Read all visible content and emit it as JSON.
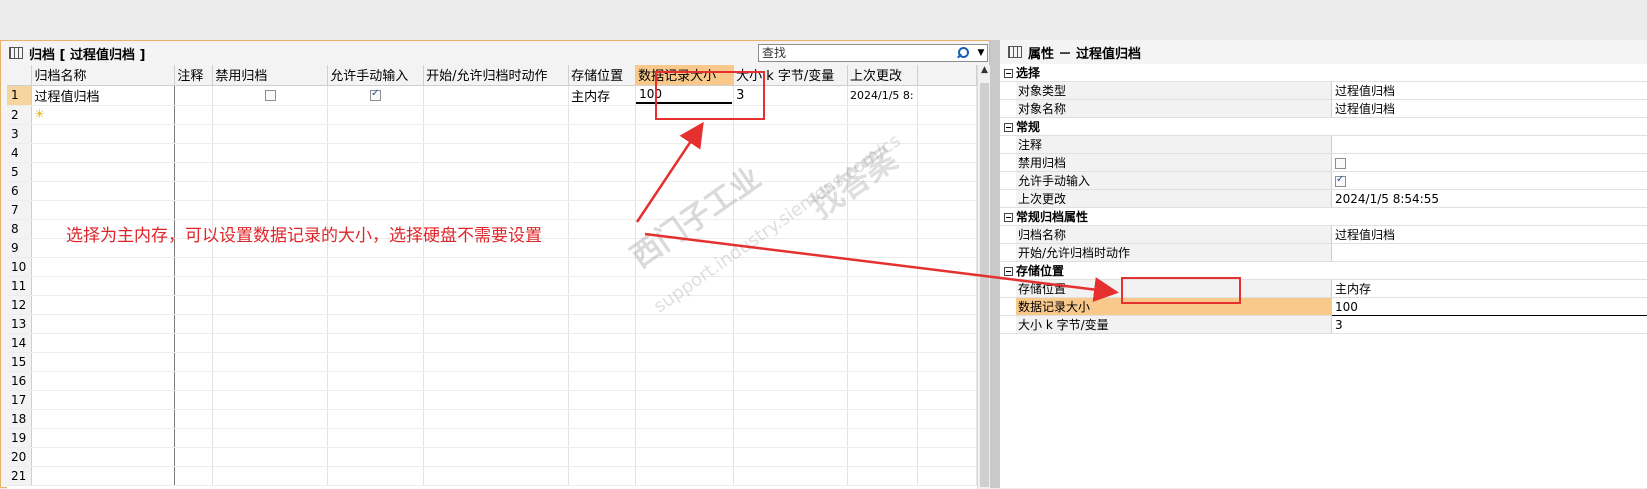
{
  "left_panel": {
    "title": "归档 [ 过程值归档 ]",
    "search_placeholder": "查找",
    "columns": [
      "归档名称",
      "注释",
      "禁用归档",
      "允许手动输入",
      "开始/允许归档时动作",
      "存储位置",
      "数据记录大小",
      "大小 k 字节/变量",
      "上次更改"
    ],
    "row1": {
      "num": "1",
      "name": "过程值归档",
      "comment": "",
      "disabled": false,
      "manual_input": true,
      "action": "",
      "storage": "主内存",
      "record_size": "100",
      "size_kb": "3",
      "last_change": "2024/1/5 8:"
    },
    "row_numbers": [
      "2",
      "3",
      "4",
      "5",
      "6",
      "7",
      "8",
      "9",
      "10",
      "11",
      "12",
      "13",
      "14",
      "15",
      "16",
      "17",
      "18",
      "19",
      "20",
      "21"
    ]
  },
  "right_panel": {
    "title": "属性 － 过程值归档",
    "categories": {
      "select": {
        "title": "选择",
        "items": [
          {
            "label": "对象类型",
            "value": "过程值归档"
          },
          {
            "label": "对象名称",
            "value": "过程值归档"
          }
        ]
      },
      "general": {
        "title": "常规",
        "items": [
          {
            "label": "注释",
            "value": ""
          },
          {
            "label": "禁用归档",
            "checked": false
          },
          {
            "label": "允许手动输入",
            "checked": true
          },
          {
            "label": "上次更改",
            "value": "2024/1/5 8:54:55"
          }
        ]
      },
      "archive_props": {
        "title": "常规归档属性",
        "items": [
          {
            "label": "归档名称",
            "value": "过程值归档"
          },
          {
            "label": "开始/允许归档时动作",
            "value": ""
          }
        ]
      },
      "storage": {
        "title": "存储位置",
        "items": [
          {
            "label": "存储位置",
            "value": "主内存"
          },
          {
            "label": "数据记录大小",
            "value": "100"
          },
          {
            "label": "大小 k 字节/变量",
            "value": "3"
          }
        ]
      }
    }
  },
  "annotation": {
    "note": "选择为主内存，可以设置数据记录的大小，选择硬盘不需要设置",
    "color": "#e53030"
  },
  "watermark": {
    "brand_cn": "西门子工业",
    "site": "support.industry.siemens.com/cs",
    "tagline": "找答案"
  }
}
